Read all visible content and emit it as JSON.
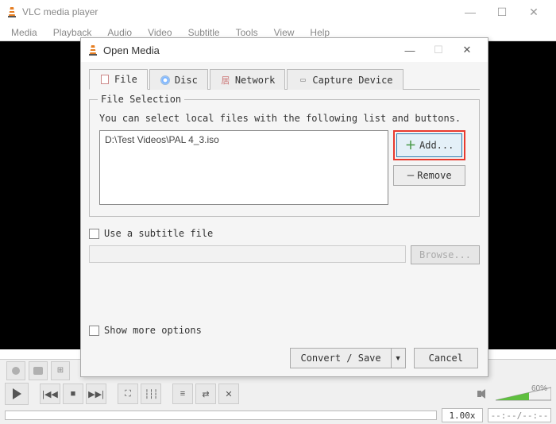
{
  "main_window": {
    "title": "VLC media player",
    "menu": [
      "Media",
      "Playback",
      "Audio",
      "Video",
      "Subtitle",
      "Tools",
      "View",
      "Help"
    ]
  },
  "playback": {
    "speed": "1.00x",
    "time": "--:--/--:--",
    "volume_percent": "60%"
  },
  "dialog": {
    "title": "Open Media",
    "tabs": {
      "file": "File",
      "disc": "Disc",
      "network": "Network",
      "capture": "Capture Device"
    },
    "file_selection": {
      "legend": "File Selection",
      "instruction": "You can select local files with the following list and buttons.",
      "files": [
        "D:\\Test Videos\\PAL 4_3.iso"
      ],
      "add_label": "Add...",
      "remove_label": "Remove"
    },
    "subtitle": {
      "checkbox_label": "Use a subtitle file",
      "browse_label": "Browse..."
    },
    "more_options_label": "Show more options",
    "footer": {
      "convert_save": "Convert / Save",
      "cancel": "Cancel"
    }
  }
}
